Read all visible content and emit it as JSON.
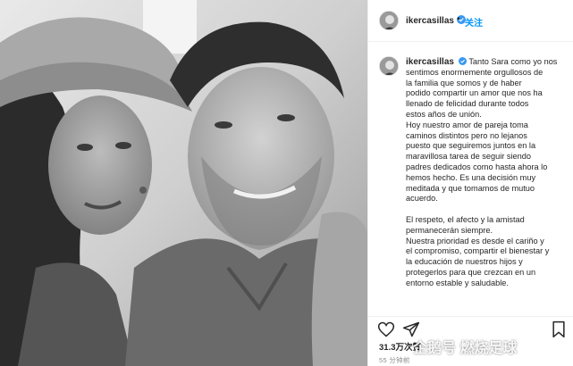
{
  "header": {
    "username": "ikercasillas",
    "separator": "•",
    "follow_label": "关注"
  },
  "caption": {
    "username": "ikercasillas",
    "lines_1": [
      "Tanto Sara como yo nos",
      "sentimos enormemente orgullosos de",
      "la familia que somos y de haber",
      "podido compartir un amor que nos ha",
      "llenado de felicidad durante todos",
      "estos años de unión.",
      "Hoy nuestro amor de pareja toma",
      "caminos distintos pero no lejanos",
      "puesto que seguiremos juntos en la",
      "maravillosa tarea de seguir siendo",
      "padres dedicados como hasta ahora lo",
      "hemos hecho. Es una decisión muy",
      "meditada y que tomamos de mutuo",
      "acuerdo."
    ],
    "lines_2": [
      "El respeto, el afecto y la amistad",
      "permanecerán siempre.",
      "Nuestra prioridad es desde el cariño y",
      "el compromiso, compartir el bienestar y",
      "la educación de nuestros hijos y",
      "protegerlos para que crezcan en un",
      "entorno estable y saludable."
    ]
  },
  "stats": {
    "likes": "31.3万次赞",
    "time": "55 分钟前"
  },
  "watermark": "企鹅号 燃烧足球",
  "icons": [
    "verified-badge-icon",
    "heart-icon",
    "share-icon",
    "bookmark-icon"
  ],
  "colors": {
    "accent": "#0095f6",
    "text": "#262626",
    "muted": "#8e8e8e",
    "border": "#efefef"
  }
}
